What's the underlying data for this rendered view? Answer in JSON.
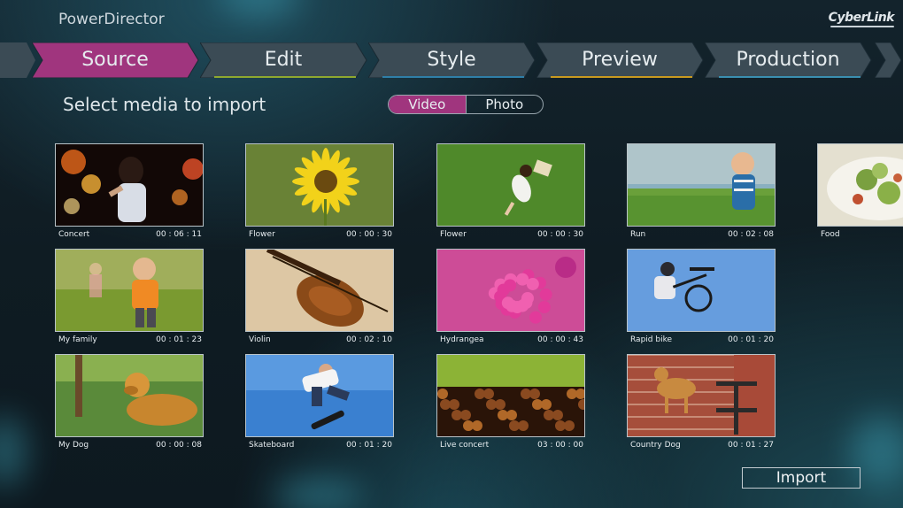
{
  "app": {
    "title": "PowerDirector",
    "brand": "CyberLink"
  },
  "workflow": {
    "steps": [
      {
        "label": "Source",
        "active": true,
        "underline": "#a0357e"
      },
      {
        "label": "Edit",
        "active": false,
        "underline": "#8fa82f"
      },
      {
        "label": "Style",
        "active": false,
        "underline": "#2f7fa8"
      },
      {
        "label": "Preview",
        "active": false,
        "underline": "#c99a1f"
      },
      {
        "label": "Production",
        "active": false,
        "underline": "#3a8fb0"
      }
    ],
    "active_color": "#a0357e",
    "inactive_color": "#3b4b55"
  },
  "import_panel": {
    "heading": "Select media to import",
    "media_types": [
      "Video",
      "Photo"
    ],
    "selected_type": "Video",
    "import_label": "Import"
  },
  "media": [
    {
      "name": "Concert",
      "duration": "00 : 06 : 11",
      "scene": "concert"
    },
    {
      "name": "Flower",
      "duration": "00 : 00 : 30",
      "scene": "sunflower"
    },
    {
      "name": "Flower",
      "duration": "00 : 00 : 30",
      "scene": "girl-grass"
    },
    {
      "name": "Run",
      "duration": "00 : 02 : 08",
      "scene": "run"
    },
    {
      "name": "Food",
      "duration": "",
      "scene": "food"
    },
    {
      "name": "My family",
      "duration": "00 : 01 : 23",
      "scene": "family"
    },
    {
      "name": "Violin",
      "duration": "00 : 02 : 10",
      "scene": "violin"
    },
    {
      "name": "Hydrangea",
      "duration": "00 : 00 : 43",
      "scene": "hydrangea"
    },
    {
      "name": "Rapid bike",
      "duration": "00 : 01 : 20",
      "scene": "bike"
    },
    {
      "name": "My Dog",
      "duration": "00 : 00 : 08",
      "scene": "dog"
    },
    {
      "name": "Skateboard",
      "duration": "00 : 01 : 20",
      "scene": "skate"
    },
    {
      "name": "Live concert",
      "duration": "03 : 00 : 00",
      "scene": "live"
    },
    {
      "name": "Country Dog",
      "duration": "00 : 01 : 27",
      "scene": "countrydog"
    }
  ]
}
